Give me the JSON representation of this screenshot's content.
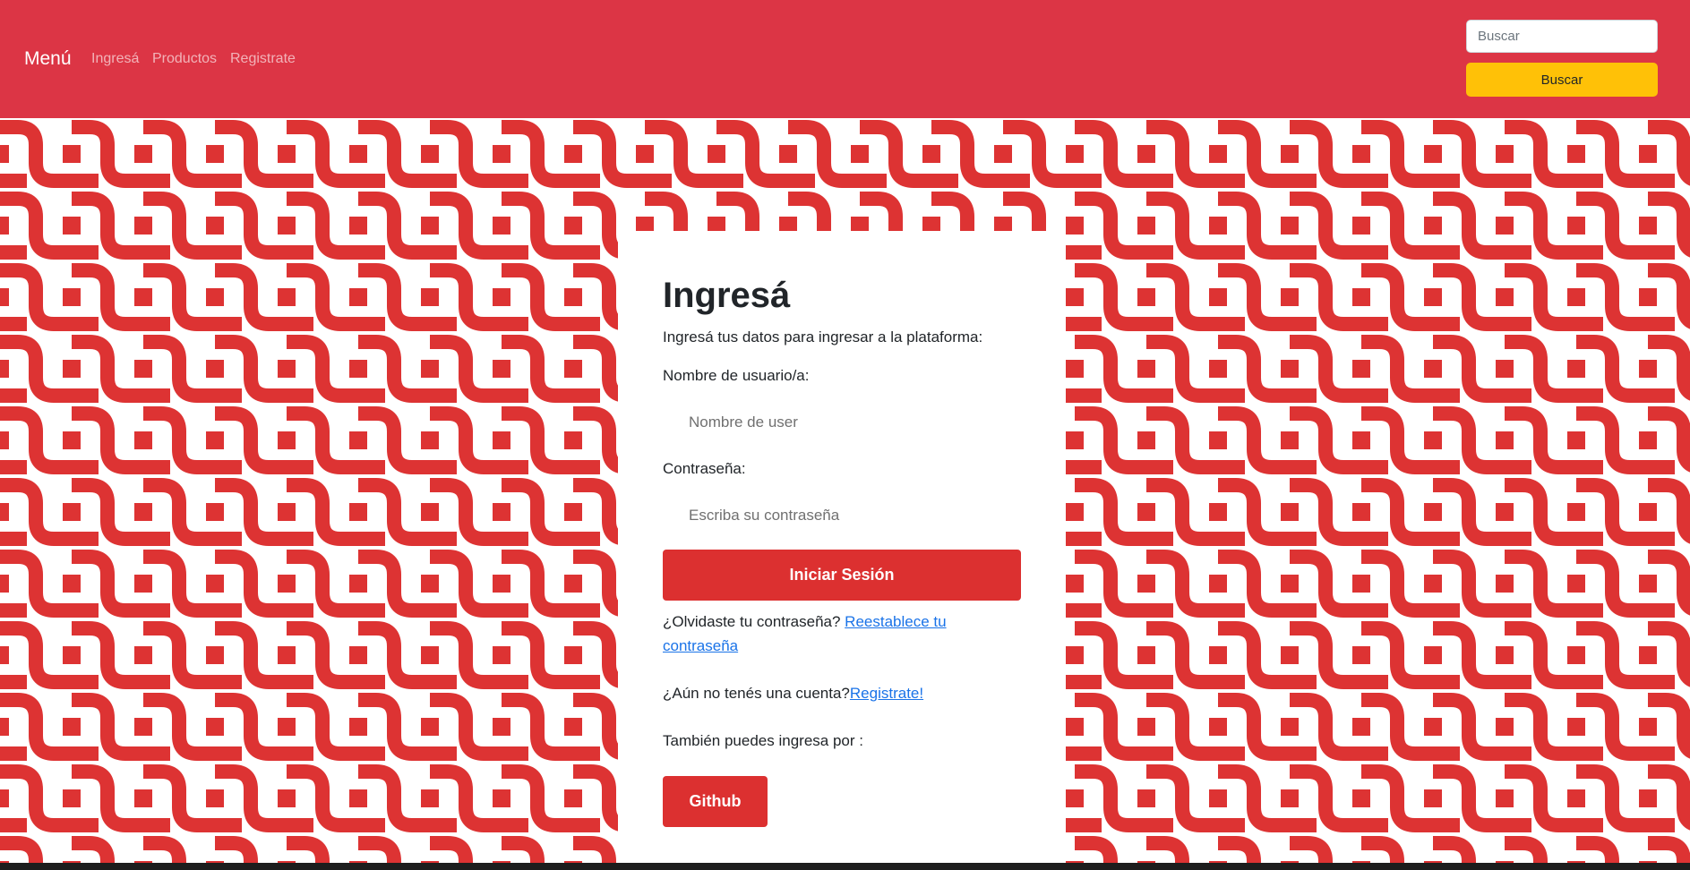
{
  "navbar": {
    "brand": "Menú",
    "links": [
      "Ingresá",
      "Productos",
      "Registrate"
    ],
    "search_placeholder": "Buscar",
    "search_button": "Buscar"
  },
  "login": {
    "title": "Ingresá",
    "subtitle": "Ingresá tus datos para ingresar a la plataforma:",
    "username_label": "Nombre de usuario/a:",
    "username_placeholder": "Nombre de user",
    "password_label": "Contraseña:",
    "password_placeholder": "Escriba su contraseña",
    "submit_label": "Iniciar Sesión",
    "forgot_text": "¿Olvidaste tu contraseña? ",
    "forgot_link_line1": "Reestablece tu",
    "forgot_link_line2": "contraseña",
    "no_account_text": "¿Aún no tenés una cuenta?",
    "register_link": "Registrate!",
    "alt_login_text": "También puedes ingresa por :",
    "github_label": "Github"
  },
  "colors": {
    "navbar": "#dc3545",
    "pattern_red": "#dd3333",
    "search_button": "#ffc107",
    "primary_button": "#dc3030",
    "link": "#1a73e8"
  }
}
